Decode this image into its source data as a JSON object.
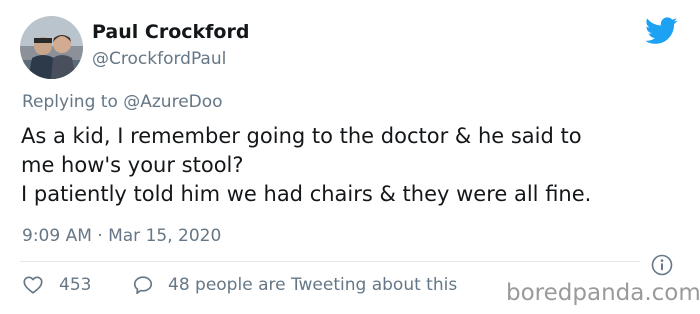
{
  "author": {
    "display_name": "Paul Crockford",
    "handle": "@CrockfordPaul",
    "avatar_icon": "avatar-photo"
  },
  "reply": {
    "prefix": "Replying to ",
    "mention": "@AzureDoo"
  },
  "body": {
    "lines": [
      "As a kid, I remember going to the doctor & he said to",
      "me how's your stool?",
      "I patiently told him we had chairs & they were all fine."
    ]
  },
  "timestamp": "9:09 AM · Mar 15, 2020",
  "actions": {
    "like_count": "453",
    "reply_text": "48 people are Tweeting about this"
  },
  "watermark": "boredpanda.com",
  "colors": {
    "twitter_blue": "#1da1f2",
    "text_primary": "#14171a",
    "text_secondary": "#657786",
    "divider": "#e1e8ed"
  }
}
